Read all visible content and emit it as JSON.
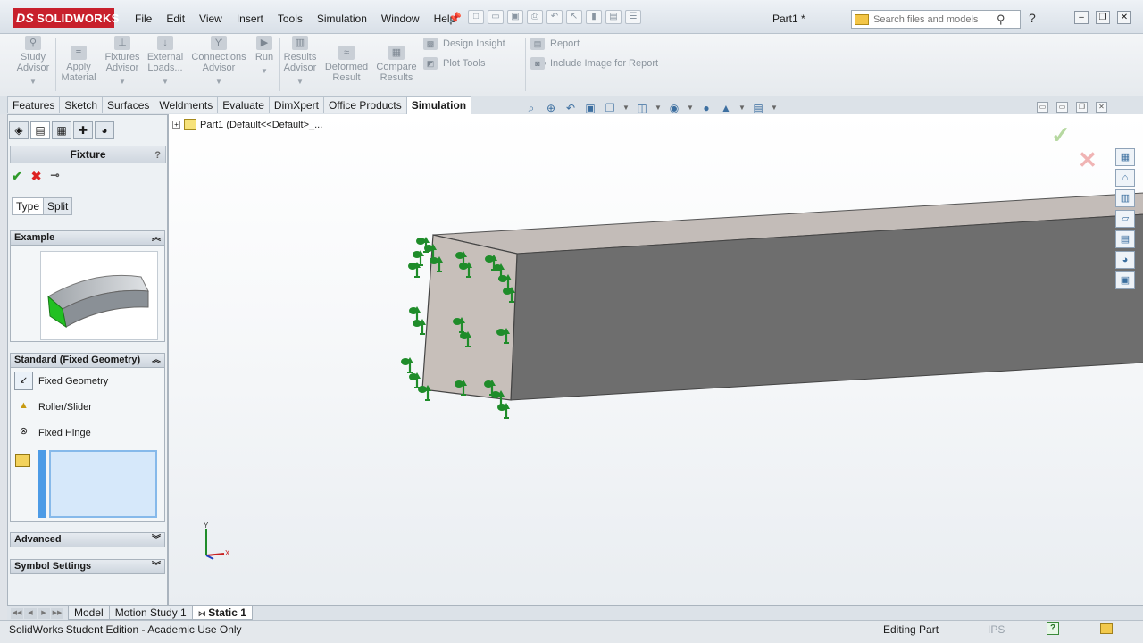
{
  "app": {
    "logo_text": "SOLIDWORKS",
    "logo_mark": "DS",
    "document_title": "Part1 *",
    "menu": [
      "File",
      "Edit",
      "View",
      "Insert",
      "Tools",
      "Simulation",
      "Window",
      "Help"
    ],
    "search_placeholder": "Search files and models",
    "help_glyph": "?"
  },
  "ribbon": {
    "buttons": [
      {
        "name": "study-advisor-button",
        "label": "Study Advisor",
        "icon": "magnifier-icon"
      },
      {
        "name": "apply-material-button",
        "label": "Apply Material",
        "icon": "material-icon"
      },
      {
        "name": "fixtures-advisor-button",
        "label": "Fixtures Advisor",
        "icon": "fixture-icon"
      },
      {
        "name": "external-loads-button",
        "label": "External Loads...",
        "icon": "load-arrow-icon"
      },
      {
        "name": "connections-advisor-button",
        "label": "Connections Advisor",
        "icon": "connector-icon"
      },
      {
        "name": "run-button",
        "label": "Run",
        "icon": "run-icon"
      },
      {
        "name": "results-advisor-button",
        "label": "Results Advisor",
        "icon": "results-icon"
      },
      {
        "name": "deformed-result-button",
        "label": "Deformed Result",
        "icon": "deformed-icon"
      },
      {
        "name": "compare-results-button",
        "label": "Compare Results",
        "icon": "compare-icon"
      }
    ],
    "design_insight": "Design Insight",
    "plot_tools": "Plot Tools",
    "report": "Report",
    "include_image": "Include Image for Report"
  },
  "command_tabs": [
    "Features",
    "Sketch",
    "Surfaces",
    "Weldments",
    "Evaluate",
    "DimXpert",
    "Office Products",
    "Simulation"
  ],
  "active_command_tab": "Simulation",
  "tree": {
    "root_label": "Part1  (Default<<Default>_..."
  },
  "property_manager": {
    "title": "Fixture",
    "help": "?",
    "subtabs": [
      "Type",
      "Split"
    ],
    "groups": {
      "example": "Example",
      "standard": "Standard (Fixed Geometry)",
      "advanced": "Advanced",
      "symbol_settings": "Symbol Settings"
    },
    "options": [
      "Fixed Geometry",
      "Roller/Slider",
      "Fixed Hinge"
    ],
    "selected_option": "Fixed Geometry"
  },
  "bottom_tabs": [
    "Model",
    "Motion Study 1",
    "Static 1"
  ],
  "active_bottom_tab": "Static 1",
  "status": {
    "left": "SolidWorks Student Edition - Academic Use Only",
    "mode": "Editing Part",
    "units": "IPS"
  },
  "triad": {
    "y_label": "Y",
    "x_label": "X"
  },
  "colors": {
    "fixture_arrow": "#1f8c2a",
    "model_face": "#6e6e6e",
    "fixed_face": "#c7bfba",
    "accent": "#c8202c"
  }
}
